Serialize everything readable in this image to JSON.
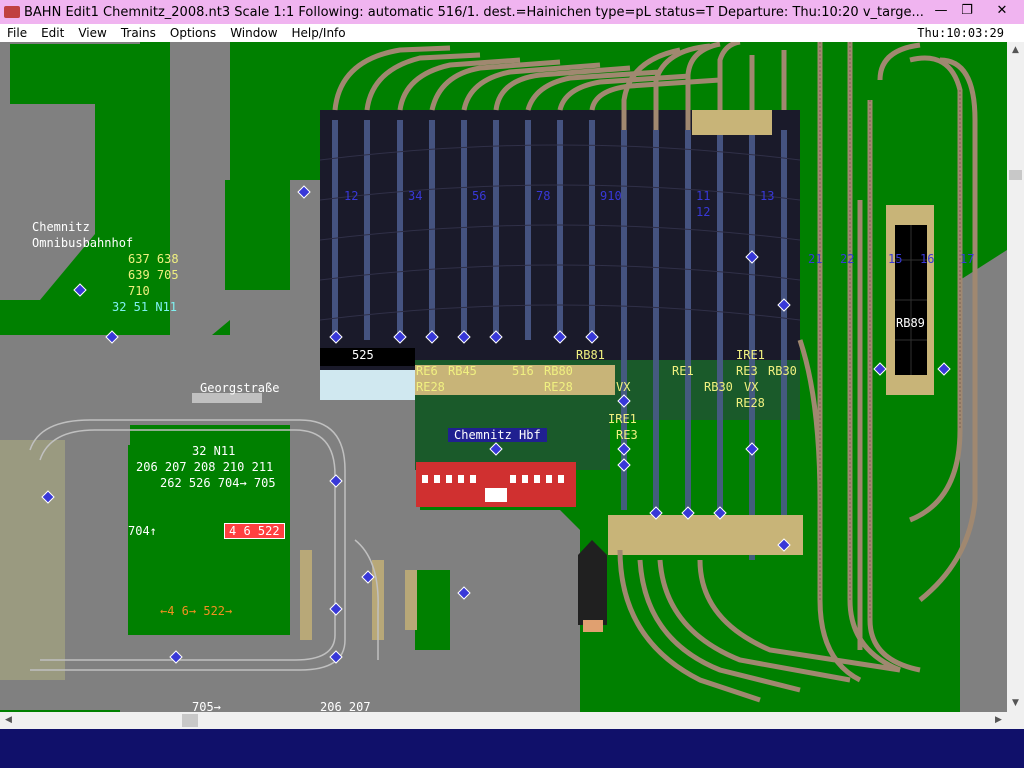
{
  "window": {
    "title": "BAHN Edit1 Chemnitz_2008.nt3 Scale 1:1 Following: automatic 516/1.  dest.=Hainichen type=pL status=T  Departure: Thu:10:20 v_targe...",
    "min_glyph": "—",
    "max_glyph": "❐",
    "close_glyph": "✕"
  },
  "menu": {
    "items": [
      "File",
      "Edit",
      "View",
      "Trains",
      "Options",
      "Window",
      "Help/Info"
    ],
    "clock": "Thu:10:03:29"
  },
  "map": {
    "bus_station": {
      "name_line1": "Chemnitz",
      "name_line2": "Omnibusbahnhof",
      "lines_row1": "637 638",
      "lines_row2": "639 705",
      "lines_row3": "710",
      "lines_row4": "32 51 N11"
    },
    "street_name": "Georgstraße",
    "station_name": "Chemnitz Hbf",
    "stop_lines": {
      "row1": "32 N11",
      "row2": "206 207 208 210 211",
      "row3": "262 526 704→ 705",
      "left": "704↑",
      "box": "4 6 522",
      "bottom": "←4 6→ 522→",
      "far_bottom": "705→",
      "bottom_right": "206 207"
    },
    "platform_numbers": [
      "12",
      "34",
      "56",
      "78",
      "910",
      "11",
      "12",
      "13",
      "21",
      "22",
      "15",
      "16",
      "17"
    ],
    "train_labels": {
      "t525": "525",
      "re6": "RE6",
      "rb45": "RB45",
      "t516": "516",
      "rb80": "RB80",
      "rb81": "RB81",
      "re28a": "RE28",
      "re28b": "RE28",
      "vx1": "VX",
      "ire1a": "IRE1",
      "re3a": "RE3",
      "re1": "RE1",
      "rb30a": "RB30",
      "vx2": "VX",
      "ire1b": "IRE1",
      "re3b": "RE3",
      "rb30b": "RB30",
      "re28c": "RE28",
      "rb89": "RB89"
    },
    "colors": {
      "grass": "#008000",
      "road": "#808080",
      "track": "#a08870",
      "roof": "#20283c",
      "platform": "#c8b478",
      "label_yellow": "#f0f080",
      "label_blue": "#3838d8",
      "station_banner": "#202090",
      "taskbar": "#10106a"
    }
  }
}
